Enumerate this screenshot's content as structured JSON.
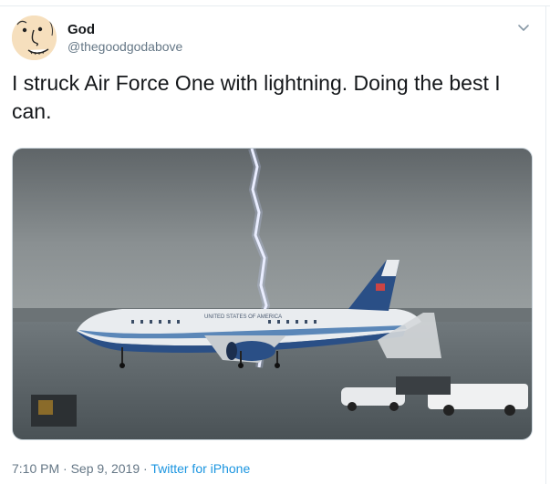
{
  "tweet": {
    "author": {
      "display_name": "God",
      "handle": "@thegoodgodabove",
      "avatar_icon": "cartoon-face-avatar"
    },
    "text": "I struck Air Force One with lightning. Doing the best I can.",
    "menu_icon": "chevron-down-icon",
    "media": {
      "airplane_markings": "UNITED STATES OF AMERICA"
    },
    "time": "7:10 PM",
    "separator": "·",
    "date": "Sep 9, 2019",
    "source": "Twitter for iPhone"
  },
  "colors": {
    "text_primary": "#14171a",
    "text_secondary": "#657786",
    "link": "#1b95e0",
    "border": "#e6ecf0"
  }
}
